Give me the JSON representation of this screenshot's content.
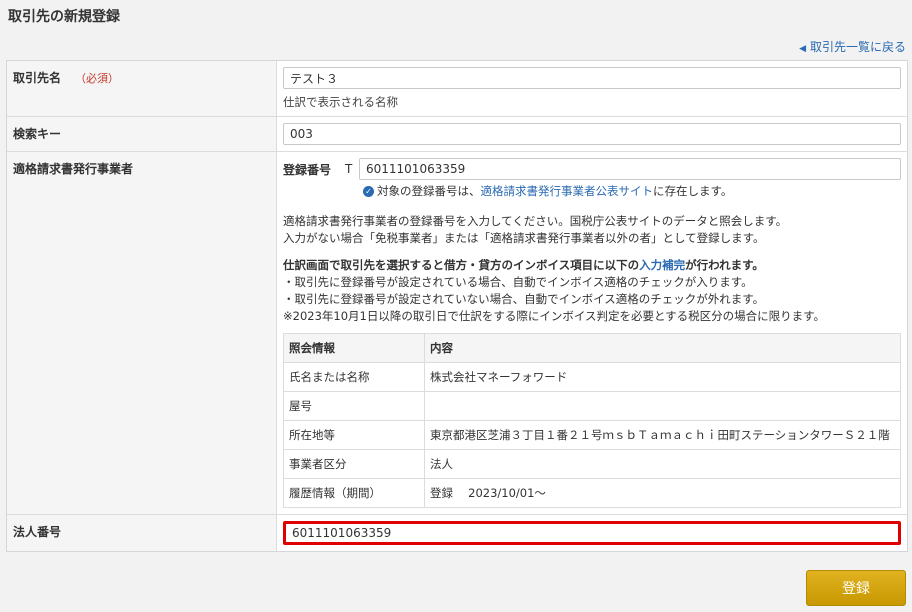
{
  "page": {
    "title": "取引先の新規登録",
    "back_link": "取引先一覧に戻る"
  },
  "rows": {
    "name": {
      "label": "取引先名",
      "required": "（必須）",
      "value": "テスト３",
      "note": "仕訳で表示される名称"
    },
    "search_key": {
      "label": "検索キー",
      "value": "003"
    },
    "invoice": {
      "label": "適格請求書発行事業者",
      "reg_label": "登録番号",
      "reg_prefix": "T",
      "reg_value": "6011101063359",
      "check_pre": "対象の登録番号は、",
      "check_link": "適格請求書発行事業者公表サイト",
      "check_post": "に存在します。",
      "desc1": "適格請求書発行事業者の登録番号を入力してください。国税庁公表サイトのデータと照会します。",
      "desc2": "入力がない場合「免税事業者」または「適格請求書発行事業者以外の者」として登録します。",
      "bold_pre": "仕訳画面で取引先を選択すると借方・貸方のインボイス項目に以下の",
      "bold_link": "入力補完",
      "bold_post": "が行われます。",
      "bullet1": "・取引先に登録番号が設定されている場合、自動でインボイス適格のチェックが入ります。",
      "bullet2": "・取引先に登録番号が設定されていない場合、自動でインボイス適格のチェックが外れます。",
      "footnote": "※2023年10月1日以降の取引日で仕訳をする際にインボイス判定を必要とする税区分の場合に限ります。",
      "table": {
        "headers": [
          "照会情報",
          "内容"
        ],
        "rows": [
          [
            "氏名または名称",
            "株式会社マネーフォワード"
          ],
          [
            "屋号",
            ""
          ],
          [
            "所在地等",
            "東京都港区芝浦３丁目１番２１号ｍｓｂＴａｍａｃｈｉ田町ステーションタワーＳ２１階"
          ],
          [
            "事業者区分",
            "法人"
          ],
          [
            "履歴情報（期間）",
            "登録　 2023/10/01〜"
          ]
        ]
      }
    },
    "corp_number": {
      "label": "法人番号",
      "value": "6011101063359"
    }
  },
  "buttons": {
    "submit": "登録"
  },
  "colors": {
    "accent": "#2a6ab3",
    "required": "#c0392b",
    "highlight": "#e00000",
    "submit": "#c79800"
  }
}
